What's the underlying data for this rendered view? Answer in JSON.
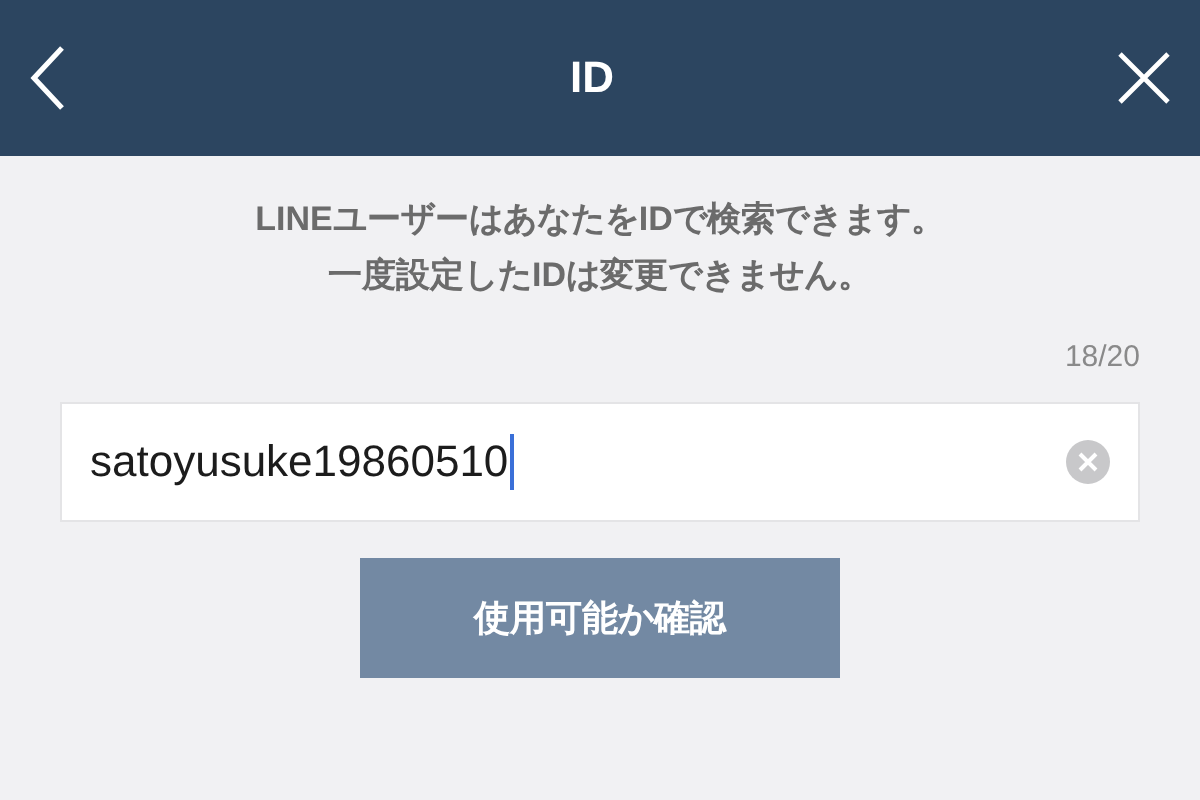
{
  "header": {
    "title": "ID"
  },
  "description": [
    "LINEユーザーはあなたをIDで検索できます。",
    "一度設定したIDは変更できません。"
  ],
  "counter": "18/20",
  "id_field": {
    "value": "satoyusuke19860510",
    "focused": true
  },
  "confirm_button": {
    "label": "使用可能か確認",
    "disabled": true
  }
}
